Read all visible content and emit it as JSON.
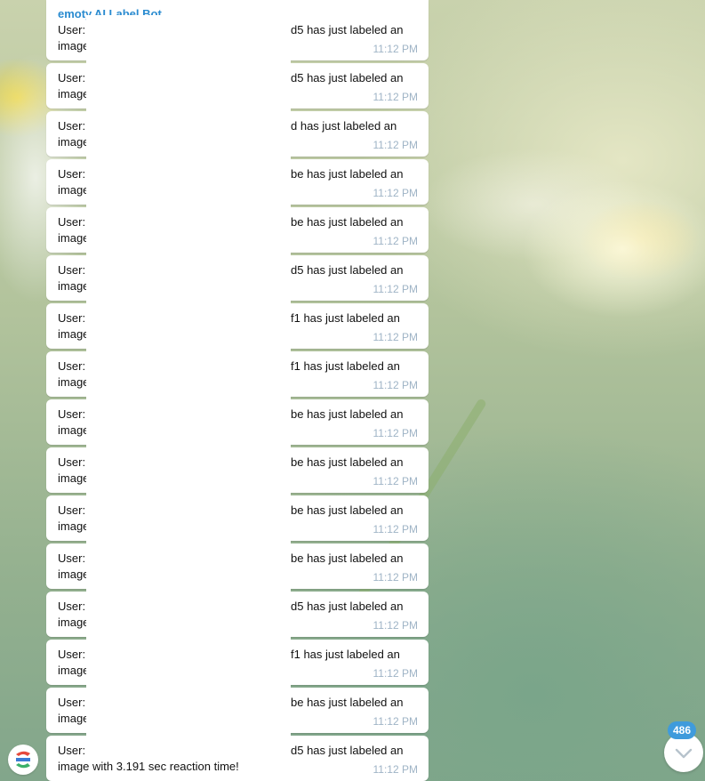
{
  "chat": {
    "bot_name": "emoty.AI Label Bot",
    "messages": [
      {
        "prefix": "User:",
        "tail": "d5 has just labeled an",
        "line2": "image",
        "time": "11:12 PM"
      },
      {
        "prefix": "User:",
        "tail": "d5 has just labeled an",
        "line2": "image",
        "time": "11:12 PM"
      },
      {
        "prefix": "User:",
        "tail": "d has just labeled an",
        "line2": "image",
        "time": "11:12 PM"
      },
      {
        "prefix": "User:",
        "tail": "be has just labeled an",
        "line2": "image",
        "time": "11:12 PM"
      },
      {
        "prefix": "User:",
        "tail": "be has just labeled an",
        "line2": "image",
        "time": "11:12 PM"
      },
      {
        "prefix": "User:",
        "tail": "d5 has just labeled an",
        "line2": "image",
        "time": "11:12 PM"
      },
      {
        "prefix": "User:",
        "tail": "f1 has just labeled an",
        "line2": "image",
        "time": "11:12 PM"
      },
      {
        "prefix": "User:",
        "tail": "f1 has just labeled an",
        "line2": "image",
        "time": "11:12 PM"
      },
      {
        "prefix": "User:",
        "tail": "be has just labeled an",
        "line2": "image",
        "time": "11:12 PM"
      },
      {
        "prefix": "User:",
        "tail": "be has just labeled an",
        "line2": "image",
        "time": "11:12 PM"
      },
      {
        "prefix": "User:",
        "tail": "be has just labeled an",
        "line2": "image",
        "time": "11:12 PM"
      },
      {
        "prefix": "User:",
        "tail": "be has just labeled an",
        "line2": "image",
        "time": "11:12 PM"
      },
      {
        "prefix": "User:",
        "tail": "d5 has just labeled an",
        "line2": "image",
        "time": "11:12 PM"
      },
      {
        "prefix": "User:",
        "tail": "f1 has just labeled an",
        "line2": "image",
        "time": "11:12 PM"
      },
      {
        "prefix": "User:",
        "tail": "be has just labeled an",
        "line2": "image",
        "time": "11:12 PM"
      },
      {
        "prefix": "User:",
        "tail": "d5 has just labeled an",
        "line2": "image with 3.191 sec reaction time!",
        "time": "11:12 PM"
      }
    ]
  },
  "scroll_down": {
    "unread_count": "486",
    "icon": "chevron-down-icon"
  },
  "avatar": {
    "icon": "bot-avatar-icon"
  },
  "colors": {
    "sender": "#2a8bd0",
    "time": "#9fb4c6",
    "badge": "#3f9bdc"
  }
}
